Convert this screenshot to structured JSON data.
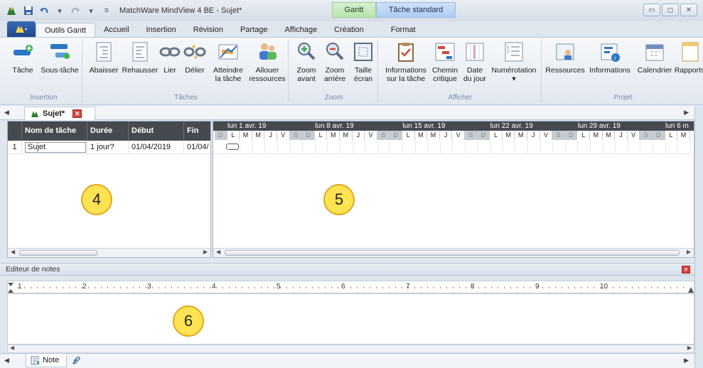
{
  "window": {
    "title": "MatchWare MindView 4 BE - Sujet*",
    "context_tab_gantt": "Gantt",
    "context_tab_task": "Tâche standard",
    "controls": [
      "▭",
      "◻",
      "✕"
    ]
  },
  "ribbon_tabs": [
    "Outils Gantt",
    "Accueil",
    "Insertion",
    "Révision",
    "Partage",
    "Affichage",
    "Création",
    "Format"
  ],
  "ribbon_groups": {
    "insertion": {
      "label": "Insertion",
      "buttons": [
        "Tâche",
        "Sous-tâche"
      ]
    },
    "taches": {
      "label": "Tâches",
      "buttons": [
        "Abaisser",
        "Rehausser",
        "Lier",
        "Délier",
        "Atteindre\nla tâche",
        "Allouer\nressources"
      ]
    },
    "zoom": {
      "label": "Zoom",
      "buttons": [
        "Zoom\navant",
        "Zoom\narrière",
        "Taille\nécran"
      ]
    },
    "afficher": {
      "label": "Afficher",
      "buttons": [
        "Informations\nsur la tâche",
        "Chemin\ncritique",
        "Date\ndu jour",
        "Numérotation"
      ]
    },
    "projet": {
      "label": "Projet",
      "buttons": [
        "Ressources",
        "Informations",
        "Calendrier",
        "Rapports"
      ]
    }
  },
  "document_tab": {
    "label": "Sujet*"
  },
  "grid": {
    "headers": [
      "Nom de tâche",
      "Durée",
      "Début",
      "Fin"
    ],
    "rows": [
      {
        "num": "1",
        "name": "Sujet",
        "duration": "1 jour?",
        "start": "01/04/2019",
        "end": "01/04/"
      }
    ]
  },
  "gantt": {
    "weeks": [
      "lun 1 avr. 19",
      "lun 8 avr. 19",
      "lun 15 avr. 19",
      "lun 22 avr. 19",
      "lun 29 avr. 19",
      "lun 6 m"
    ],
    "days": [
      "D",
      "L",
      "M",
      "M",
      "J",
      "V",
      "S",
      "D",
      "L",
      "M",
      "M",
      "J",
      "V",
      "S",
      "D",
      "L",
      "M",
      "M",
      "J",
      "V",
      "S",
      "D",
      "L",
      "M",
      "M",
      "J",
      "V",
      "S",
      "D",
      "L",
      "M",
      "M",
      "J",
      "V",
      "S",
      "D",
      "L",
      "M"
    ]
  },
  "callouts": {
    "grid": "4",
    "gantt": "5",
    "notes": "6"
  },
  "notes": {
    "header": "Editeur de notes",
    "ruler_numbers": [
      "1",
      "2",
      "3",
      "4",
      "5",
      "6",
      "7",
      "8",
      "9",
      "10"
    ],
    "bottom_tab": "Note"
  }
}
